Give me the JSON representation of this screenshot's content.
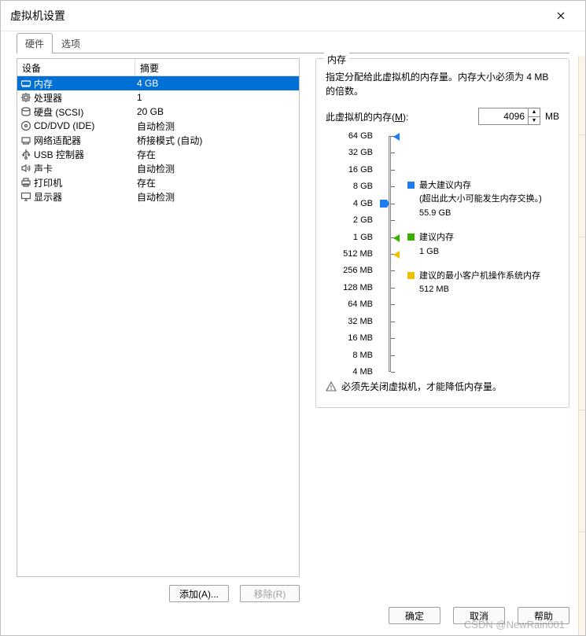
{
  "window": {
    "title": "虚拟机设置"
  },
  "tabs": {
    "hardware": "硬件",
    "options": "选项"
  },
  "hw_table": {
    "col_device": "设备",
    "col_summary": "摘要",
    "rows": [
      {
        "icon": "memory",
        "name": "内存",
        "summary": "4 GB",
        "selected": true
      },
      {
        "icon": "cpu",
        "name": "处理器",
        "summary": "1"
      },
      {
        "icon": "disk",
        "name": "硬盘 (SCSI)",
        "summary": "20 GB"
      },
      {
        "icon": "cd",
        "name": "CD/DVD (IDE)",
        "summary": "自动检测"
      },
      {
        "icon": "net",
        "name": "网络适配器",
        "summary": "桥接模式 (自动)"
      },
      {
        "icon": "usb",
        "name": "USB 控制器",
        "summary": "存在"
      },
      {
        "icon": "sound",
        "name": "声卡",
        "summary": "自动检测"
      },
      {
        "icon": "printer",
        "name": "打印机",
        "summary": "存在"
      },
      {
        "icon": "display",
        "name": "显示器",
        "summary": "自动检测"
      }
    ],
    "add_btn": "添加(A)...",
    "remove_btn": "移除(R)"
  },
  "mem_panel": {
    "title": "内存",
    "desc": "指定分配给此虚拟机的内存量。内存大小必须为 4 MB 的倍数。",
    "mem_label_pre": "此虚拟机的内存(",
    "mem_label_mn": "M",
    "mem_label_post": "):",
    "mem_value": "4096",
    "mem_unit": "MB",
    "scale_ticks": [
      {
        "label": "64 GB",
        "pct": 0.0
      },
      {
        "label": "32 GB",
        "pct": 0.0714
      },
      {
        "label": "16 GB",
        "pct": 0.1429
      },
      {
        "label": "8 GB",
        "pct": 0.2143
      },
      {
        "label": "4 GB",
        "pct": 0.2857
      },
      {
        "label": "2 GB",
        "pct": 0.3571
      },
      {
        "label": "1 GB",
        "pct": 0.4286
      },
      {
        "label": "512 MB",
        "pct": 0.5
      },
      {
        "label": "256 MB",
        "pct": 0.5714
      },
      {
        "label": "128 MB",
        "pct": 0.6429
      },
      {
        "label": "64 MB",
        "pct": 0.7143
      },
      {
        "label": "32 MB",
        "pct": 0.7857
      },
      {
        "label": "16 MB",
        "pct": 0.8571
      },
      {
        "label": "8 MB",
        "pct": 0.9286
      },
      {
        "label": "4 MB",
        "pct": 1.0
      }
    ],
    "slider_value_pct": 0.2857,
    "markers": [
      {
        "color": "#1e7df0",
        "pct": 0.0
      },
      {
        "color": "#39b000",
        "pct": 0.4286
      },
      {
        "color": "#f0c000",
        "pct": 0.5
      }
    ],
    "legend_max": {
      "color": "#1e7df0",
      "t1": "最大建议内存",
      "t2": "(超出此大小可能发生内存交换。)",
      "t3": "55.9 GB"
    },
    "legend_rec": {
      "color": "#39b000",
      "t1": "建议内存",
      "t2": "1 GB"
    },
    "legend_min": {
      "color": "#f0c000",
      "t1": "建议的最小客户机操作系统内存",
      "t2": "512 MB"
    },
    "warn": "必须先关闭虚拟机，才能降低内存量。"
  },
  "dlg": {
    "ok": "确定",
    "cancel": "取消",
    "help": "帮助"
  },
  "watermark": "CSDN @NewRain001"
}
